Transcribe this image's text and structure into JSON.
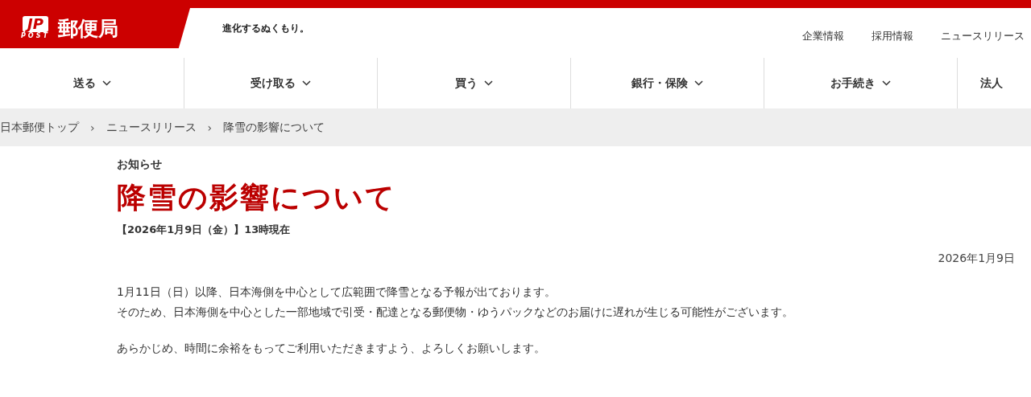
{
  "header": {
    "logo": {
      "mark": "JP",
      "sub": "POST",
      "name": "郵便局"
    },
    "tagline": "進化するぬくもり。",
    "utility_links": [
      "企業情報",
      "採用情報",
      "ニュースリリース"
    ]
  },
  "nav": [
    {
      "label": "送る",
      "chevron": true
    },
    {
      "label": "受け取る",
      "chevron": true
    },
    {
      "label": "買う",
      "chevron": true
    },
    {
      "label": "銀行・保険",
      "chevron": true
    },
    {
      "label": "お手続き",
      "chevron": true
    },
    {
      "label": "法人",
      "chevron": false
    }
  ],
  "breadcrumb": [
    {
      "label": "日本郵便トップ"
    },
    {
      "separator": "›",
      "label": "ニュースリリース"
    },
    {
      "separator": "›",
      "label": "降雪の影響について"
    }
  ],
  "article": {
    "category": "お知らせ",
    "title": "降雪の影響について",
    "subtitle": "【2026年1月9日（金）】13時現在",
    "date": "2026年1月9日",
    "paragraphs": [
      [
        "1月11日（日）以降、日本海側を中心として広範囲で降雪となる予報が出ております。",
        "そのため、日本海側を中心とした一部地域で引受・配達となる郵便物・ゆうパックなどのお届けに遅れが生じる可能性がございます。"
      ],
      [
        "あらかじめ、時間に余裕をもってご利用いただきますよう、よろしくお願いします。"
      ]
    ]
  }
}
